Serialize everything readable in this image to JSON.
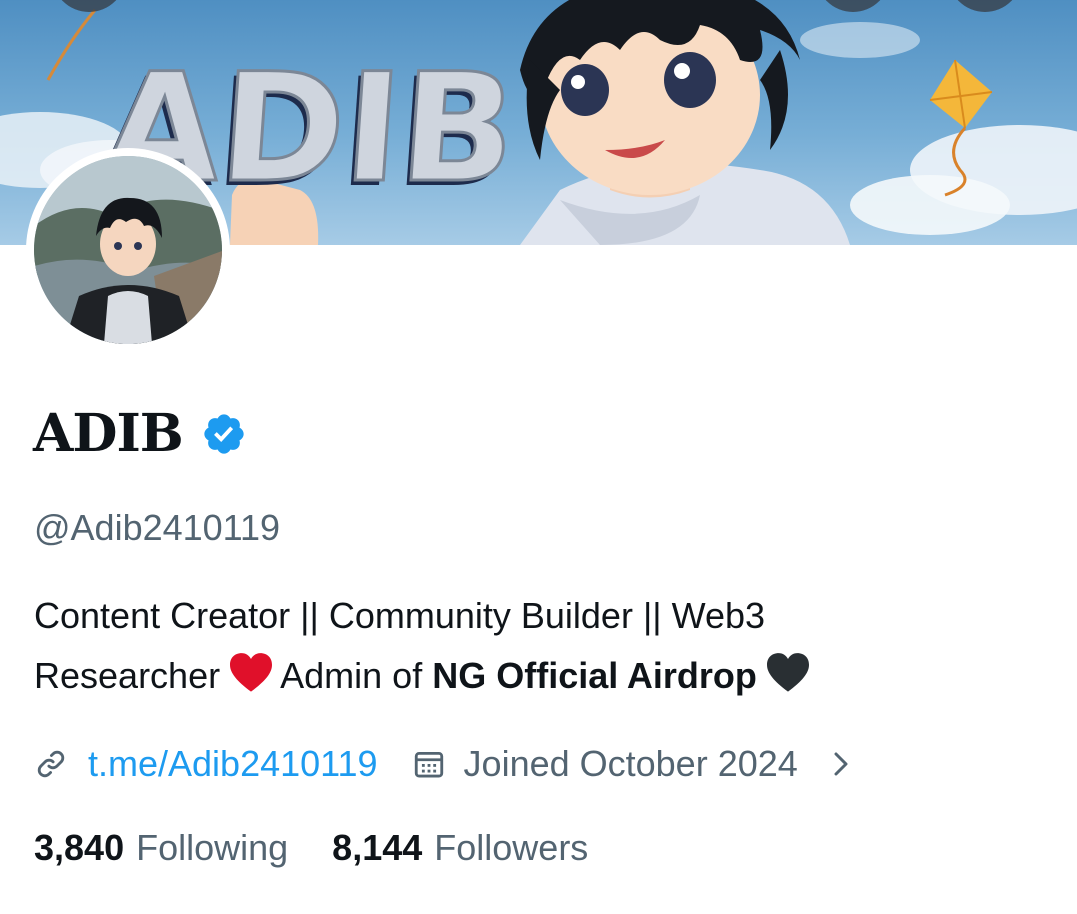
{
  "banner": {
    "text": "ADIB"
  },
  "profile": {
    "display_name": "ADIB",
    "verified": true,
    "handle": "@Adib2410119",
    "bio": {
      "line1": "Content Creator || Community Builder || Web3",
      "line2_a": "Researcher",
      "line2_b": "Admin of",
      "line2_bold": "NG Official Airdrop"
    },
    "link": "t.me/Adib2410119",
    "joined": "Joined October 2024",
    "following_count": "3,840",
    "following_label": "Following",
    "followers_count": "8,144",
    "followers_label": "Followers"
  },
  "icons": {
    "verified": "verified-badge-icon",
    "link": "link-icon",
    "calendar": "calendar-icon",
    "chevron": "chevron-right-icon",
    "heart_red": "red-heart-emoji",
    "heart_black": "black-heart-emoji"
  },
  "colors": {
    "accent": "#1d9bf0",
    "secondary_text": "#536471",
    "primary_text": "#0f1419",
    "heart_red": "#e0102a",
    "heart_black": "#292f33"
  }
}
